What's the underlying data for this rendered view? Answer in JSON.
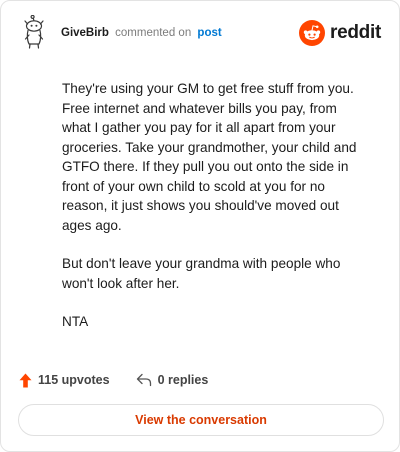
{
  "comment": {
    "username": "GiveBirb",
    "action_text": "commented on",
    "post_link": "post",
    "paragraphs": [
      "They're using your GM to get free stuff from you. Free internet and whatever bills you pay, from what I gather you pay for it all apart from your groceries. Take your grandmother, your child and GTFO there. If they pull you out onto the side in front of your own child to scold at you for no reason, it just shows you should've moved out ages ago.",
      "But don't leave your grandma with people who won't look after her.",
      "NTA"
    ]
  },
  "brand": {
    "name": "reddit",
    "color": "#ff4500"
  },
  "footer": {
    "upvotes_label": "115 upvotes",
    "replies_label": "0 replies",
    "upvote_color": "#ff4500"
  },
  "cta": {
    "label": "View the conversation",
    "color": "#d93a00"
  },
  "icons": {
    "avatar": "snoo-avatar-icon",
    "logo": "reddit-alien-icon",
    "upvote": "upvote-arrow-icon",
    "reply": "reply-arrow-icon"
  }
}
